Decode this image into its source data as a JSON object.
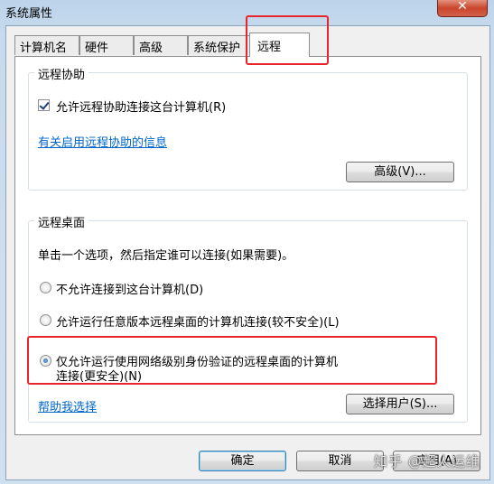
{
  "window": {
    "title": "系统属性",
    "close_symbol": "✕"
  },
  "tabs": [
    {
      "label": "计算机名"
    },
    {
      "label": "硬件"
    },
    {
      "label": "高级"
    },
    {
      "label": "系统保护"
    },
    {
      "label": "远程"
    }
  ],
  "remote_assistance": {
    "group_label": "远程协助",
    "allow_label": "允许远程协助连接这台计算机(R)",
    "allow_checked": true,
    "info_link": "有关启用远程协助的信息",
    "advanced_button": "高级(V)..."
  },
  "remote_desktop": {
    "group_label": "远程桌面",
    "instruction": "单击一个选项，然后指定谁可以连接(如果需要)。",
    "options": [
      {
        "label": "不允许连接到这台计算机(D)",
        "selected": false
      },
      {
        "label": "允许运行任意版本远程桌面的计算机连接(较不安全)(L)",
        "selected": false
      },
      {
        "label_line1": "仅允许运行使用网络级别身份验证的远程桌面的计算机",
        "label_line2": "连接(更安全)(N)",
        "selected": true
      }
    ],
    "help_link": "帮助我选择",
    "select_users_button": "选择用户(S)..."
  },
  "footer": {
    "ok_button": "确定",
    "cancel_button": "取消",
    "apply_button": "应用(A)"
  },
  "watermark": "知乎 @超人运维",
  "colors": {
    "highlight": "#e8262a",
    "link": "#0066cc"
  }
}
